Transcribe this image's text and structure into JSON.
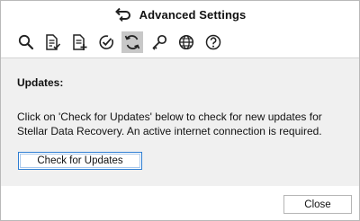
{
  "window": {
    "title": "Advanced Settings",
    "title_icon": "back-arrow-icon"
  },
  "toolbar": {
    "items": [
      {
        "icon": "search-icon",
        "active": false
      },
      {
        "icon": "file-list-icon",
        "active": false
      },
      {
        "icon": "file-add-icon",
        "active": false
      },
      {
        "icon": "check-circle-icon",
        "active": false
      },
      {
        "icon": "update-icon",
        "active": true
      },
      {
        "icon": "key-icon",
        "active": false
      },
      {
        "icon": "globe-icon",
        "active": false
      },
      {
        "icon": "help-icon",
        "active": false
      }
    ]
  },
  "section": {
    "title": "Updates:",
    "description": "Click on 'Check for Updates' below to check for new updates for Stellar Data Recovery. An active internet connection is required.",
    "check_button_label": "Check for Updates"
  },
  "footer": {
    "close_label": "Close"
  },
  "colors": {
    "content_bg": "#f0f0f0",
    "active_tool_bg": "#c8c8c8",
    "focus_border": "#2d7dd2"
  }
}
